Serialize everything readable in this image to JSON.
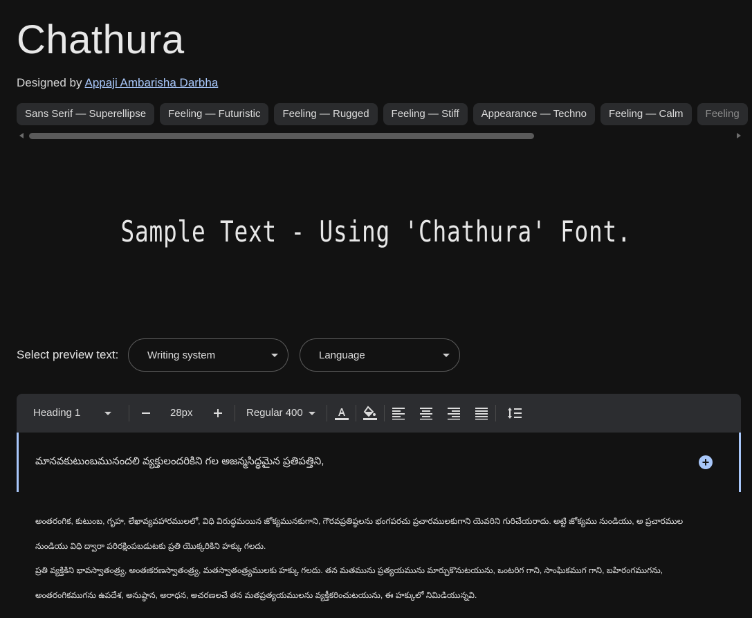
{
  "header": {
    "title": "Chathura",
    "designed_by_prefix": "Designed by",
    "designer_name": "Appaji Ambarisha Darbha"
  },
  "tags": [
    "Sans Serif — Superellipse",
    "Feeling — Futuristic",
    "Feeling — Rugged",
    "Feeling — Stiff",
    "Appearance — Techno",
    "Feeling — Calm",
    "Feeling"
  ],
  "sample_text": "Sample Text - Using 'Chathura' Font.",
  "preview": {
    "label": "Select preview text:",
    "writing_system": "Writing system",
    "language": "Language"
  },
  "toolbar": {
    "style": "Heading 1",
    "size": "28px",
    "weight": "Regular 400",
    "icons": [
      "minus-icon",
      "plus-icon",
      "text-color-icon",
      "highlight-icon",
      "align-left-icon",
      "align-center-icon",
      "align-right-icon",
      "align-justify-icon",
      "line-spacing-icon"
    ]
  },
  "editor": {
    "first_line": "మానవకుటుంబమునందలి వ్యక్తులందరికిని గల అజన్మసిద్ధమైన ప్రతిపత్తిని,",
    "lines": [
      "అంతరంగిక, కుటుంబ, గృహ, లేఖావ్యవహారములలో, విధి విరుద్ధమయిన జోక్యమునకుగాని, గౌరవప్రతిష్ఠలను భంగపరచు ప్రచారములకుగాని యెవరిని గురిచేయరాదు. అట్టి జోక్యము నుండియు, అ ప్రచారముల",
      "నుండియు విధి ద్వారా పరిరక్షింపబడుటకు ప్రతి యొక్కరికిని హక్కు గలదు.",
      "ప్రతి వ్యక్తికిని భావస్వాతంత్ర్య, అంతఃకరణస్వాతంత్ర్య, మతస్వాతంత్ర్యములకు హక్కు గలదు. తన మతమును ప్రత్యయమును మార్చుకొనుటయును, ఒంటరిగ గాని, సాంఘికముగ గాని, బహిరంగముగను,",
      "అంతరంగికముగను ఉపదేశ, అనుష్ఠాన, అరాధన, అచరణలచే తన మతప్రత్యయములను వ్యక్తీకరించుటయును, ఈ హక్కులో నిమిడియున్నవి."
    ]
  },
  "colors": {
    "background": "#121212",
    "chip": "#2a2b2d",
    "toolbar": "#2c2d30",
    "accent": "#a8c7fa"
  }
}
